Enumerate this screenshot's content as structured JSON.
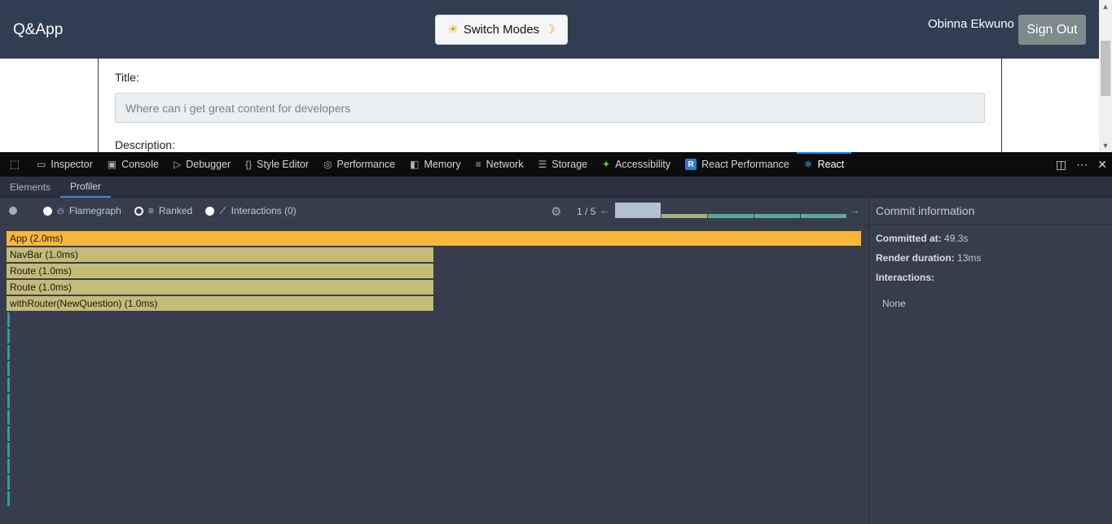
{
  "app": {
    "brand": "Q&App",
    "switch_modes_label": "Switch Modes",
    "user_name": "Obinna Ekwuno",
    "sign_out_label": "Sign Out",
    "form": {
      "title_label": "Title:",
      "title_value": "Where can i get great content for developers",
      "description_label": "Description:"
    }
  },
  "devtools": {
    "tabs": [
      {
        "label": "Inspector",
        "icon": "inspector-icon"
      },
      {
        "label": "Console",
        "icon": "console-icon"
      },
      {
        "label": "Debugger",
        "icon": "debugger-icon"
      },
      {
        "label": "Style Editor",
        "icon": "style-editor-icon"
      },
      {
        "label": "Performance",
        "icon": "performance-icon"
      },
      {
        "label": "Memory",
        "icon": "memory-icon"
      },
      {
        "label": "Network",
        "icon": "network-icon"
      },
      {
        "label": "Storage",
        "icon": "storage-icon"
      },
      {
        "label": "Accessibility",
        "icon": "accessibility-icon"
      },
      {
        "label": "React Performance",
        "icon": "react-performance-icon"
      },
      {
        "label": "React",
        "icon": "react-icon",
        "active": true
      }
    ]
  },
  "react_devtools": {
    "subtabs": [
      "Elements",
      "Profiler"
    ],
    "active_subtab": "Profiler",
    "profiler": {
      "views": [
        "Flamegraph",
        "Ranked",
        "Interactions (0)"
      ],
      "selected_view": "Ranked",
      "commit_position": "1 / 5",
      "commits": [
        {
          "level": 0.3,
          "color": "#b3c0d4"
        },
        {
          "level": 0.12,
          "color": "#a5b37e"
        },
        {
          "level": 0.1,
          "color": "#5fa796"
        },
        {
          "level": 0.1,
          "color": "#5fa796"
        },
        {
          "level": 0.1,
          "color": "#5fa796"
        }
      ],
      "flamegraph": [
        {
          "label": "App (2.0ms)",
          "width_fraction": 1.0,
          "color": "#f8b73b"
        },
        {
          "label": "NavBar (1.0ms)",
          "width_fraction": 0.5,
          "color": "#c4bb76"
        },
        {
          "label": "Route (1.0ms)",
          "width_fraction": 0.5,
          "color": "#c4bb76"
        },
        {
          "label": "Route (1.0ms)",
          "width_fraction": 0.5,
          "color": "#c4bb76"
        },
        {
          "label": "withRouter(NewQuestion) (1.0ms)",
          "width_fraction": 0.5,
          "color": "#c4bb76"
        }
      ],
      "thin_rows": 12
    },
    "commit_info": {
      "title": "Commit information",
      "committed_at_label": "Committed at:",
      "committed_at_value": "49.3s",
      "render_duration_label": "Render duration:",
      "render_duration_value": "13ms",
      "interactions_label": "Interactions:",
      "interactions_value": "None"
    }
  }
}
